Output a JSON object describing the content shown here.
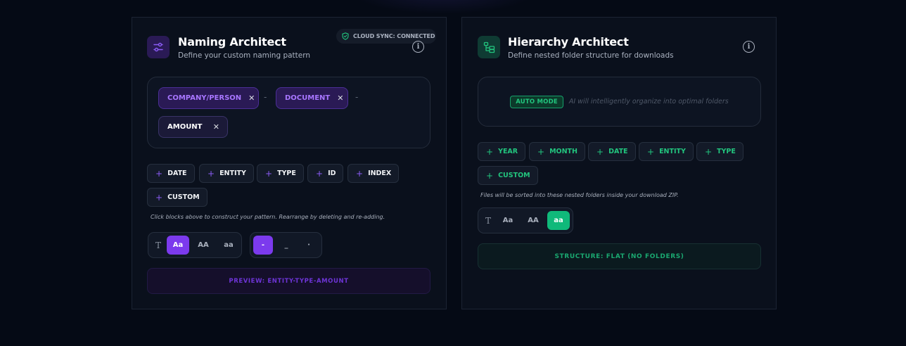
{
  "naming": {
    "title": "Naming Architect",
    "subtitle": "Define your custom naming pattern",
    "sync_badge": "CLOUD SYNC: CONNECTED",
    "tokens": [
      {
        "label": "COMPANY/PERSON",
        "remove": "✕"
      },
      {
        "label": "DOCUMENT",
        "remove": "✕"
      },
      {
        "label": "AMOUNT",
        "remove": "✕"
      }
    ],
    "separator": "-",
    "blocks": [
      "DATE",
      "ENTITY",
      "TYPE",
      "ID",
      "INDEX",
      "CUSTOM"
    ],
    "hint": "Click blocks above to construct your pattern. Rearrange by deleting and re-adding.",
    "case_options": [
      "T",
      "Aa",
      "AA",
      "aa"
    ],
    "case_selected": "Aa",
    "separator_options": [
      "-",
      "_",
      "·"
    ],
    "separator_selected": "-",
    "preview": "PREVIEW: ENTITY-TYPE-AMOUNT"
  },
  "hierarchy": {
    "title": "Hierarchy Architect",
    "subtitle": "Define nested folder structure for downloads",
    "auto_badge": "AUTO MODE",
    "auto_text": "AI will intelligently organize into optimal folders",
    "blocks": [
      "YEAR",
      "MONTH",
      "DATE",
      "ENTITY",
      "TYPE",
      "CUSTOM"
    ],
    "hint": "Files will be sorted into these nested folders inside your download ZIP.",
    "case_options": [
      "T",
      "Aa",
      "AA",
      "aa"
    ],
    "case_selected": "aa",
    "structure": "STRUCTURE: FLAT (NO FOLDERS)"
  },
  "colors": {
    "accent_purple": "#7c3aed",
    "accent_green": "#10b97a",
    "background": "#050a15"
  },
  "icons": {
    "naming": "sliders-icon",
    "hierarchy": "folder-tree-icon",
    "info": "info-icon",
    "sync": "shield-check-icon",
    "remove": "close-icon",
    "add": "plus-icon"
  }
}
